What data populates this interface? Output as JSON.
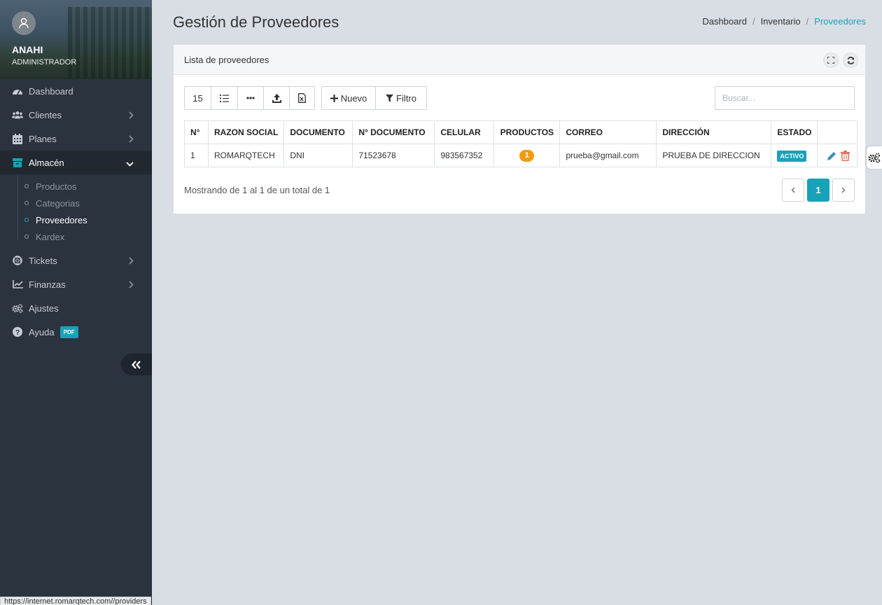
{
  "profile": {
    "name": "ANAHI",
    "role": "ADMINISTRADOR"
  },
  "sidebar": {
    "items": [
      {
        "label": "Dashboard",
        "icon": "dashboard-gauge-icon"
      },
      {
        "label": "Clientes",
        "icon": "users-icon"
      },
      {
        "label": "Planes",
        "icon": "calendar-icon"
      },
      {
        "label": "Almacén",
        "icon": "archive-box-icon"
      },
      {
        "label": "Tickets",
        "icon": "life-ring-icon"
      },
      {
        "label": "Finanzas",
        "icon": "line-chart-icon"
      },
      {
        "label": "Ajustes",
        "icon": "cogs-icon"
      },
      {
        "label": "Ayuda",
        "icon": "question-circle-icon",
        "badge": "PDF"
      }
    ],
    "submenu": [
      "Productos",
      "Categorias",
      "Proveedores",
      "Kardex"
    ]
  },
  "header": {
    "title": "Gestión de Proveedores",
    "breadcrumb": [
      "Dashboard",
      "Inventario",
      "Proveedores"
    ]
  },
  "card": {
    "title": "Lista de proveedores",
    "page_size": "15",
    "new_label": "Nuevo",
    "filter_label": "Filtro",
    "search_placeholder": "Buscar...",
    "columns": [
      "N°",
      "RAZON SOCIAL",
      "DOCUMENTO",
      "N° DOCUMENTO",
      "CELULAR",
      "PRODUCTOS",
      "CORREO",
      "DIRECCIÓN",
      "ESTADO"
    ],
    "rows": [
      {
        "n": "1",
        "razon_social": "ROMARQTECH",
        "documento": "DNI",
        "num_documento": "71523678",
        "celular": "983567352",
        "productos": "1",
        "correo": "prueba@gmail.com",
        "direccion": "PRUEBA DE DIRECCION",
        "estado": "ACTIVO"
      }
    ],
    "info": "Mostrando de 1 al 1 de un total de 1",
    "current_page": "1"
  },
  "statusbar": "https://internet.romarqtech.com//providers",
  "colors": {
    "accent": "#17a2b8",
    "sidebar": "#2b333e",
    "badge_orange": "#f39c12",
    "delete_red": "#e0664f",
    "edit_blue": "#3c8dbc"
  }
}
